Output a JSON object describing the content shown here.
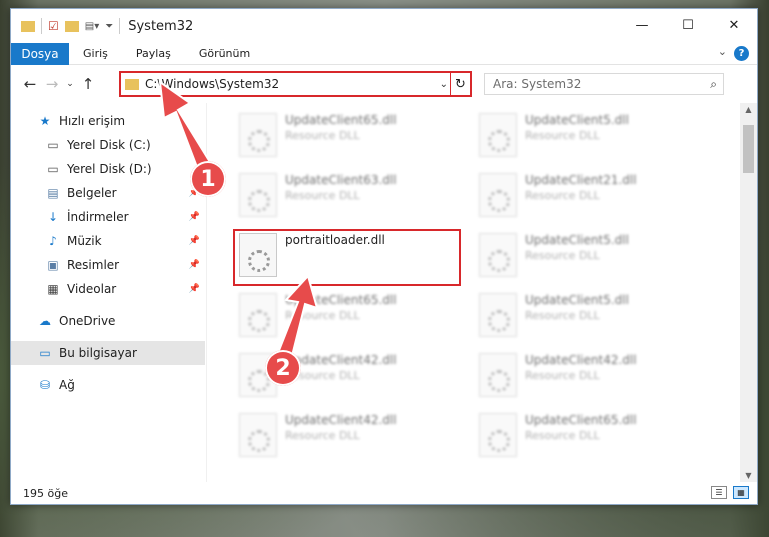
{
  "window": {
    "title": "System32"
  },
  "caption": {
    "minimize": "—",
    "maximize": "☐",
    "close": "✕"
  },
  "ribbon": {
    "tabs": [
      "Dosya",
      "Giriş",
      "Paylaş",
      "Görünüm"
    ],
    "help": "?"
  },
  "address": {
    "path": "C:\\Windows\\System32",
    "search_placeholder": "Ara: System32"
  },
  "nav": {
    "items": [
      {
        "label": "Hızlı erişim",
        "icon": "star-icon"
      },
      {
        "label": "Yerel Disk (C:)",
        "icon": "drive-icon"
      },
      {
        "label": "Yerel Disk (D:)",
        "icon": "drive-icon"
      },
      {
        "label": "Belgeler",
        "icon": "documents-icon"
      },
      {
        "label": "İndirmeler",
        "icon": "download-icon"
      },
      {
        "label": "Müzik",
        "icon": "music-icon"
      },
      {
        "label": "Resimler",
        "icon": "pictures-icon"
      },
      {
        "label": "Videolar",
        "icon": "videos-icon"
      },
      {
        "label": "OneDrive",
        "icon": "cloud-icon"
      },
      {
        "label": "Bu bilgisayar",
        "icon": "computer-icon"
      },
      {
        "label": "Ağ",
        "icon": "network-icon"
      }
    ]
  },
  "files": [
    {
      "name": "UpdateClient65.dll",
      "type": "Resource DLL"
    },
    {
      "name": "UpdateClient5.dll",
      "type": "Resource DLL"
    },
    {
      "name": "UpdateClient63.dll",
      "type": "Resource DLL"
    },
    {
      "name": "UpdateClient21.dll",
      "type": "Resource DLL"
    },
    {
      "name": "portraitloader.dll",
      "type": ""
    },
    {
      "name": "UpdateClient5.dll",
      "type": "Resource DLL"
    },
    {
      "name": "UpdateClient65.dll",
      "type": "Resource DLL"
    },
    {
      "name": "UpdateClient5.dll",
      "type": "Resource DLL"
    },
    {
      "name": "UpdateClient42.dll",
      "type": "Resource DLL"
    },
    {
      "name": "UpdateClient42.dll",
      "type": "Resource DLL"
    },
    {
      "name": "UpdateClient42.dll",
      "type": "Resource DLL"
    },
    {
      "name": "UpdateClient65.dll",
      "type": "Resource DLL"
    }
  ],
  "status": {
    "count": "195 öğe"
  },
  "annotations": {
    "step1": "1",
    "step2": "2"
  },
  "colors": {
    "accent": "#1979ca",
    "highlight": "#d8282b",
    "badge": "#e74b4b"
  }
}
